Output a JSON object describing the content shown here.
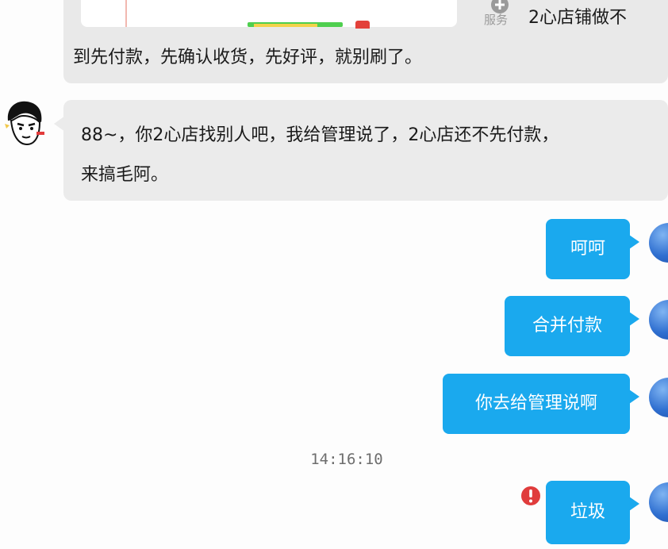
{
  "top_message": {
    "service_label": "服务",
    "line1": "2心店铺做不",
    "line2": "到先付款，先确认收货，先好评，就别刷了。"
  },
  "incoming_message": {
    "line1": "88~，你2心店找别人吧，我给管理说了，2心店还不先付款，",
    "line2": "来搞毛阿。"
  },
  "outgoing_messages": [
    {
      "text": "呵呵"
    },
    {
      "text": "合并付款"
    },
    {
      "text": "你去给管理说啊"
    },
    {
      "text": "垃圾",
      "failed": true
    }
  ],
  "timestamp": "14:16:10",
  "colors": {
    "outgoing_bubble": "#1aa9ee",
    "incoming_bubble": "#ebebeb",
    "error_badge": "#e03c3c"
  },
  "icons": {
    "service": "plus-circle-icon",
    "send_failed": "exclamation-circle-icon"
  }
}
